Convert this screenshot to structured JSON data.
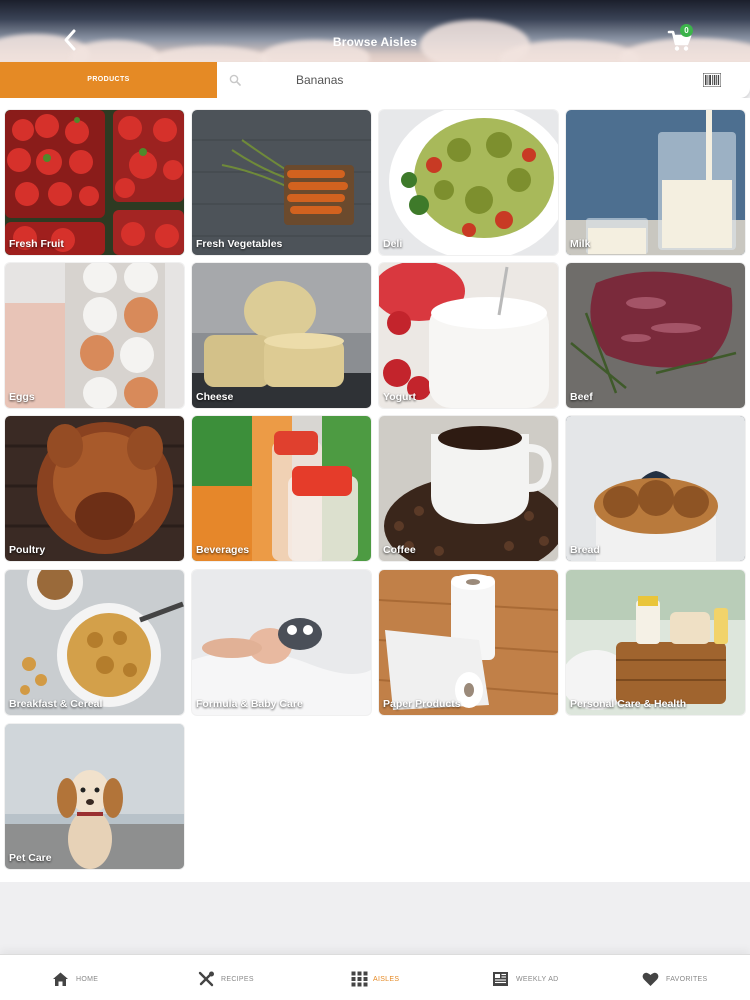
{
  "header": {
    "title": "Browse Aisles",
    "back_icon": "chevron-left-icon",
    "cart_icon": "cart-icon",
    "cart_count": "0"
  },
  "search": {
    "tab_label": "PRODUCTS",
    "placeholder": "Bananas",
    "search_icon": "search-icon",
    "barcode_icon": "barcode-icon"
  },
  "aisles": [
    {
      "label": "Fresh Fruit"
    },
    {
      "label": "Fresh Vegetables"
    },
    {
      "label": "Deli"
    },
    {
      "label": "Milk"
    },
    {
      "label": "Eggs"
    },
    {
      "label": "Cheese"
    },
    {
      "label": "Yogurt"
    },
    {
      "label": "Beef"
    },
    {
      "label": "Poultry"
    },
    {
      "label": "Beverages"
    },
    {
      "label": "Coffee"
    },
    {
      "label": "Bread"
    },
    {
      "label": "Breakfast & Cereal"
    },
    {
      "label": "Formula & Baby Care"
    },
    {
      "label": "Paper Products"
    },
    {
      "label": "Personal Care & Health"
    },
    {
      "label": "Pet Care"
    }
  ],
  "nav": {
    "items": [
      {
        "label": "HOME",
        "icon": "home-icon"
      },
      {
        "label": "RECIPES",
        "icon": "utensils-icon"
      },
      {
        "label": "AISLES",
        "icon": "grid-icon",
        "active": true
      },
      {
        "label": "WEEKLY AD",
        "icon": "newspaper-icon"
      },
      {
        "label": "FAVORITES",
        "icon": "heart-icon"
      }
    ]
  },
  "colors": {
    "accent": "#e58a25",
    "badge": "#3cb44b",
    "nav_inactive": "#888888"
  }
}
